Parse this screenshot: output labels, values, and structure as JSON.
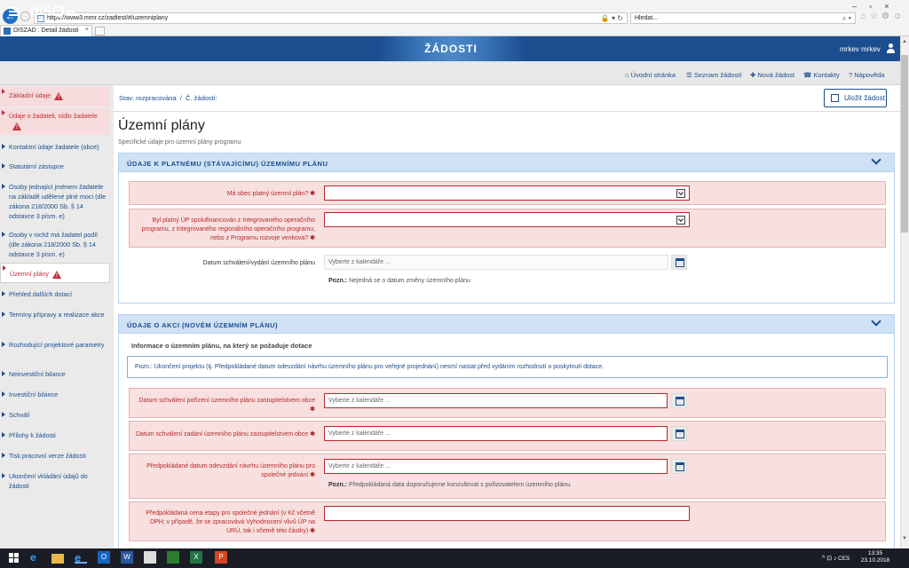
{
  "browser": {
    "url": "https://www3.mmr.cz/zadtest/#/uzemniplany",
    "search_placeholder": "Hledat...",
    "tab_title": "DISZAD : Detail žádosti"
  },
  "header": {
    "logo": "DIS",
    "logo_sub": "ŽÁDOSTI",
    "logo_mm": "MMR",
    "title": "ŽÁDOSTI",
    "user": "mrkev mrkev"
  },
  "topnav": {
    "home": "Úvodní stránka",
    "list": "Seznam žádostí",
    "new": "Nová žádost",
    "contacts": "Kontakty",
    "help": "Nápověda"
  },
  "sidebar": {
    "items": [
      "Základní údaje",
      "Údaje o žadateli, sídlo žadatele",
      "Kontaktní údaje žadatele (obce)",
      "Statutární zástupce",
      "Osoby jednající jménem žadatele na základě udělené plné moci (dle zákona 218/2000 Sb. § 14 odstavce 3 písm. e)",
      "Osoby v nichž má žadatel podíl (dle zákona 218/2000 Sb. § 14 odstavce 3 písm. e)",
      "Územní plány",
      "Přehled dalších dotací",
      "Termíny přípravy a realizace akce",
      "Rozhodující projektové parametry",
      "Neinvestiční bilance",
      "Investiční bilance",
      "Schválí",
      "Přílohy k žádosti",
      "Tisk pracovní verze žádosti",
      "Ukončení vkládání údajů do žádosti"
    ]
  },
  "main": {
    "crumb_status": "Stav: rozpracována",
    "crumb_sep": "/",
    "crumb_no": "Č. žádosti:",
    "save_label": "Uložit žádost",
    "title": "Územní plány",
    "subtitle": "Specifické údaje pro územní plány programu",
    "section1": {
      "title": "ÚDAJE K PLATNÉMU (STÁVAJÍCÍMU) ÚZEMNÍMU PLÁNU",
      "field1_label": "Má obec platný územní plán?",
      "field2_label": "Byl platný ÚP spolufinancován z Integrovaného operačního programu, z Integrovaného regionálního operačního programu, nebo z Programu rozvoje venkova?",
      "field3_label": "Datum schválení/vydání územního plánu",
      "field3_placeholder": "Vyberte z kalendáře ...",
      "field3_note_b": "Pozn.:",
      "field3_note": "Nejedná se o datum změny územního plánu"
    },
    "section2": {
      "title": "ÚDAJE O AKCI (NOVÉM ÚZEMNÍM PLÁNU)",
      "subheading": "Informace o územním plánu, na který se požaduje dotace",
      "info": "Pozn.: Ukončení projektu (tj. Předpokládané datum odevzdání návrhu územního plánu pro veřejné projednání) nesmí nastat před vydáním rozhodnutí o poskytnutí dotace.",
      "f1_label": "Datum schválení pořízení územního plánu zastupitelstvem obce",
      "f2_label": "Datum schválení zadání územního plánu zastupitelstvem obce",
      "f3_label": "Předpokládané datum odevzdání návrhu územního plánu pro společné jednání",
      "f3_note_b": "Pozn.:",
      "f3_note": "Předpokládaná data doporučujeme konzultovat s pořizovatelem územního plánu.",
      "f4_label": "Předpokládaná cena etapy pro společné jednání (v Kč včetně DPH; v případě, že se zpracovává Vyhodnocení vlivů ÚP na URÚ, tak i včetně této částky)",
      "placeholder": "Vyberte z kalendáře ..."
    }
  },
  "taskbar": {
    "lang": "CES",
    "time": "13:35",
    "date": "23.10.2018"
  }
}
